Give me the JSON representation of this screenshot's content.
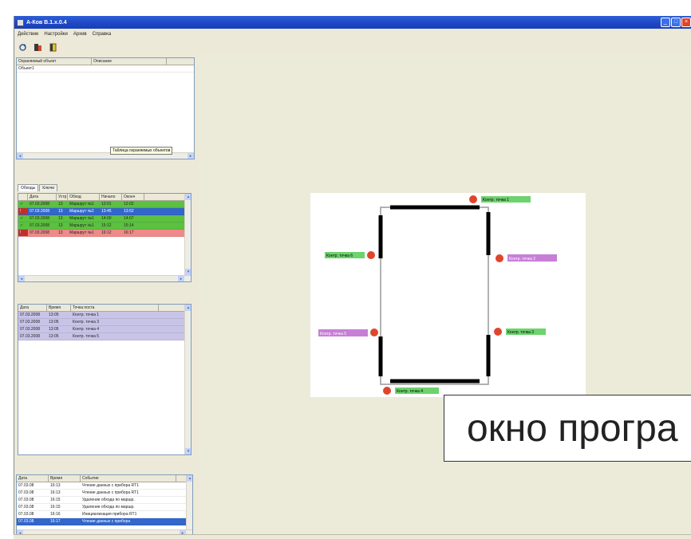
{
  "window": {
    "title": "А-Ков В.1.х.0.4"
  },
  "menu": [
    "Действие",
    "Настройки",
    "Архив",
    "Справка"
  ],
  "objects_grid": {
    "headers": [
      "Охраняемый объект",
      "Описание"
    ],
    "rows": [
      {
        "name": "Объект1",
        "desc": ""
      }
    ]
  },
  "tabs": [
    "Обходы",
    "Ключи"
  ],
  "tooltip": "Таблица охраняемых объектов",
  "rounds_grid": {
    "headers": [
      "",
      "Дата",
      "Устр",
      "Обход",
      "Начало",
      "Оконч"
    ],
    "rows": [
      {
        "date": "07.03.2008",
        "dev": "13",
        "route": "Маршрут №1",
        "start": "12:01",
        "end": "12:02",
        "status": "ok"
      },
      {
        "date": "07.03.2008",
        "dev": "13",
        "route": "Маршрут №1",
        "start": "13:45",
        "end": "13:52",
        "status": "selected"
      },
      {
        "date": "07.03.2008",
        "dev": "13",
        "route": "Маршрут №1",
        "start": "14:00",
        "end": "14:07",
        "status": "ok"
      },
      {
        "date": "07.03.2008",
        "dev": "13",
        "route": "Маршрут №1",
        "start": "15:12",
        "end": "15:14",
        "status": "ok"
      },
      {
        "date": "07.03.2008",
        "dev": "13",
        "route": "Маршрут №1",
        "start": "16:12",
        "end": "16:17",
        "status": "bad"
      }
    ]
  },
  "points_grid": {
    "headers": [
      "Дата",
      "Время",
      "Точка поста"
    ],
    "rows": [
      {
        "date": "07.03.2008",
        "time": "13:05",
        "point": "Контр. точка 1"
      },
      {
        "date": "07.03.2008",
        "time": "13:05",
        "point": "Контр. точка 3"
      },
      {
        "date": "07.03.2008",
        "time": "13:05",
        "point": "Контр. точка 4"
      },
      {
        "date": "07.03.2008",
        "time": "13:05",
        "point": "Контр. точка 5"
      }
    ]
  },
  "events_grid": {
    "headers": [
      "Дата",
      "Время",
      "Событие"
    ],
    "rows": [
      {
        "date": "07.03.08",
        "time": "16:13",
        "event": "Чтение данных с прибора RT1"
      },
      {
        "date": "07.03.08",
        "time": "16:13",
        "event": "Чтение данных с прибора RT1"
      },
      {
        "date": "07.03.08",
        "time": "16:15",
        "event": "Удаление обхода по маршр."
      },
      {
        "date": "07.03.08",
        "time": "16:15",
        "event": "Удаление обхода по маршр."
      },
      {
        "date": "07.03.08",
        "time": "16:16",
        "event": "Инициализация прибора RT1"
      },
      {
        "date": "07.03.08",
        "time": "16:17",
        "event": "Чтение данных с прибора"
      }
    ]
  },
  "map_points": [
    {
      "label": "Контр. точка 1",
      "status": "ok"
    },
    {
      "label": "Контр. точка 2",
      "status": "missed"
    },
    {
      "label": "Контр. точка 3",
      "status": "ok"
    },
    {
      "label": "Контр. точка 4",
      "status": "ok"
    },
    {
      "label": "Контр. точка 5",
      "status": "missed"
    },
    {
      "label": "Контр. точка 6",
      "status": "ok"
    }
  ],
  "caption": "окно програ",
  "colors": {
    "ok_row": "#5cc040",
    "bad_row": "#ef8a8a",
    "selected_row": "#3366cc",
    "purple_row": "#c8c4e8",
    "point_ok": "#6dd36d",
    "point_missed": "#c77fd6",
    "marker": "#e0452c",
    "titlebar": "#1d46c4"
  }
}
